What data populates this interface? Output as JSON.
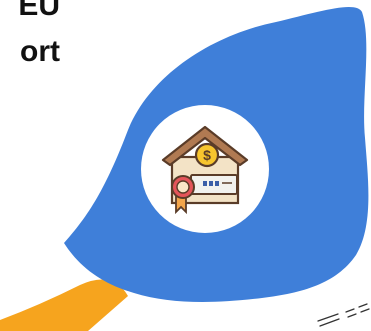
{
  "heading": {
    "line1": "EU",
    "line2": "ort"
  },
  "icon": {
    "name": "house-with-price-tag-icon",
    "dollar_symbol": "$"
  },
  "colors": {
    "blob": "#3F7FD9",
    "orange": "#F6A41E",
    "circle": "#FFFFFF",
    "roof": "#B07A52",
    "roof_outline": "#5A3C28",
    "dollar_badge": "#F7C52E",
    "tag": "#F2F2EE",
    "seal": "#E4555A",
    "ribbon": "#F3A54A",
    "text": "#111111"
  }
}
